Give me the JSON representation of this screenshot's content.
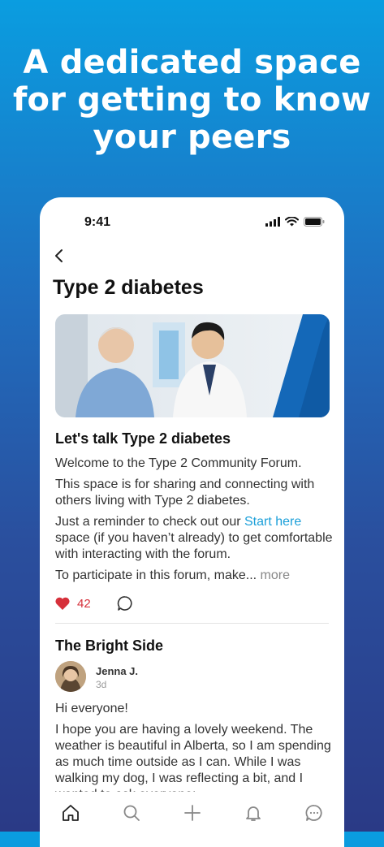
{
  "headline": {
    "line1": "A dedicated space",
    "line2": "for getting to know",
    "line3": "your peers"
  },
  "status_bar": {
    "time": "9:41",
    "icons": [
      "signal-icon",
      "wifi-icon",
      "battery-icon"
    ]
  },
  "nav": {
    "back_icon": "chevron-left-icon"
  },
  "page": {
    "title": "Type 2 diabetes"
  },
  "post": {
    "title": "Let's talk Type 2 diabetes",
    "p1": "Welcome to the Type 2 Community Forum.",
    "p2": "This space is for sharing and connecting with others living with Type 2 diabetes.",
    "p3_before": "Just a reminder to check out our ",
    "p3_link": "Start here",
    "p3_after": " space (if you haven’t already) to get comfortable with interacting with the forum.",
    "p4": "To participate in this forum, make...",
    "more": " more",
    "likes": "42"
  },
  "thread": {
    "title": "The Bright Side",
    "author": "Jenna J.",
    "time": "3d",
    "greeting": "Hi everyone!",
    "body": "I hope you are having a lovely weekend. The weather is beautiful in Alberta, so I am spending as much time outside as I can. While I was walking my dog, I was reflecting a bit, and I wanted to ask everyone:"
  },
  "tabbar": {
    "items": [
      "home-icon",
      "search-icon",
      "plus-icon",
      "bell-icon",
      "chat-icon"
    ]
  },
  "colors": {
    "accent_link": "#1a9fd9",
    "heart": "#d6303a"
  }
}
